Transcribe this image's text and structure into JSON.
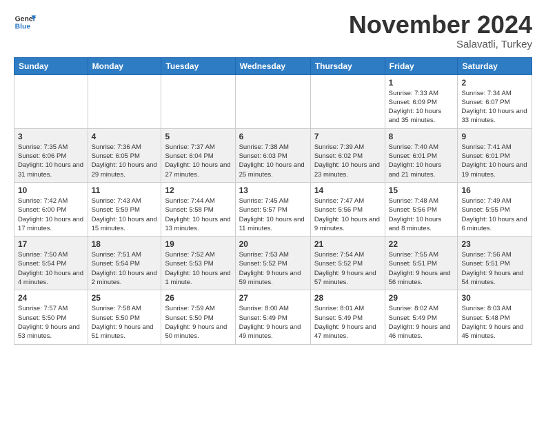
{
  "logo": {
    "line1": "General",
    "line2": "Blue"
  },
  "title": "November 2024",
  "subtitle": "Salavatli, Turkey",
  "days_of_week": [
    "Sunday",
    "Monday",
    "Tuesday",
    "Wednesday",
    "Thursday",
    "Friday",
    "Saturday"
  ],
  "weeks": [
    [
      {
        "day": "",
        "info": ""
      },
      {
        "day": "",
        "info": ""
      },
      {
        "day": "",
        "info": ""
      },
      {
        "day": "",
        "info": ""
      },
      {
        "day": "",
        "info": ""
      },
      {
        "day": "1",
        "info": "Sunrise: 7:33 AM\nSunset: 6:09 PM\nDaylight: 10 hours\nand 35 minutes."
      },
      {
        "day": "2",
        "info": "Sunrise: 7:34 AM\nSunset: 6:07 PM\nDaylight: 10 hours\nand 33 minutes."
      }
    ],
    [
      {
        "day": "3",
        "info": "Sunrise: 7:35 AM\nSunset: 6:06 PM\nDaylight: 10 hours\nand 31 minutes."
      },
      {
        "day": "4",
        "info": "Sunrise: 7:36 AM\nSunset: 6:05 PM\nDaylight: 10 hours\nand 29 minutes."
      },
      {
        "day": "5",
        "info": "Sunrise: 7:37 AM\nSunset: 6:04 PM\nDaylight: 10 hours\nand 27 minutes."
      },
      {
        "day": "6",
        "info": "Sunrise: 7:38 AM\nSunset: 6:03 PM\nDaylight: 10 hours\nand 25 minutes."
      },
      {
        "day": "7",
        "info": "Sunrise: 7:39 AM\nSunset: 6:02 PM\nDaylight: 10 hours\nand 23 minutes."
      },
      {
        "day": "8",
        "info": "Sunrise: 7:40 AM\nSunset: 6:01 PM\nDaylight: 10 hours\nand 21 minutes."
      },
      {
        "day": "9",
        "info": "Sunrise: 7:41 AM\nSunset: 6:01 PM\nDaylight: 10 hours\nand 19 minutes."
      }
    ],
    [
      {
        "day": "10",
        "info": "Sunrise: 7:42 AM\nSunset: 6:00 PM\nDaylight: 10 hours\nand 17 minutes."
      },
      {
        "day": "11",
        "info": "Sunrise: 7:43 AM\nSunset: 5:59 PM\nDaylight: 10 hours\nand 15 minutes."
      },
      {
        "day": "12",
        "info": "Sunrise: 7:44 AM\nSunset: 5:58 PM\nDaylight: 10 hours\nand 13 minutes."
      },
      {
        "day": "13",
        "info": "Sunrise: 7:45 AM\nSunset: 5:57 PM\nDaylight: 10 hours\nand 11 minutes."
      },
      {
        "day": "14",
        "info": "Sunrise: 7:47 AM\nSunset: 5:56 PM\nDaylight: 10 hours\nand 9 minutes."
      },
      {
        "day": "15",
        "info": "Sunrise: 7:48 AM\nSunset: 5:56 PM\nDaylight: 10 hours\nand 8 minutes."
      },
      {
        "day": "16",
        "info": "Sunrise: 7:49 AM\nSunset: 5:55 PM\nDaylight: 10 hours\nand 6 minutes."
      }
    ],
    [
      {
        "day": "17",
        "info": "Sunrise: 7:50 AM\nSunset: 5:54 PM\nDaylight: 10 hours\nand 4 minutes."
      },
      {
        "day": "18",
        "info": "Sunrise: 7:51 AM\nSunset: 5:54 PM\nDaylight: 10 hours\nand 2 minutes."
      },
      {
        "day": "19",
        "info": "Sunrise: 7:52 AM\nSunset: 5:53 PM\nDaylight: 10 hours\nand 1 minute."
      },
      {
        "day": "20",
        "info": "Sunrise: 7:53 AM\nSunset: 5:52 PM\nDaylight: 9 hours\nand 59 minutes."
      },
      {
        "day": "21",
        "info": "Sunrise: 7:54 AM\nSunset: 5:52 PM\nDaylight: 9 hours\nand 57 minutes."
      },
      {
        "day": "22",
        "info": "Sunrise: 7:55 AM\nSunset: 5:51 PM\nDaylight: 9 hours\nand 56 minutes."
      },
      {
        "day": "23",
        "info": "Sunrise: 7:56 AM\nSunset: 5:51 PM\nDaylight: 9 hours\nand 54 minutes."
      }
    ],
    [
      {
        "day": "24",
        "info": "Sunrise: 7:57 AM\nSunset: 5:50 PM\nDaylight: 9 hours\nand 53 minutes."
      },
      {
        "day": "25",
        "info": "Sunrise: 7:58 AM\nSunset: 5:50 PM\nDaylight: 9 hours\nand 51 minutes."
      },
      {
        "day": "26",
        "info": "Sunrise: 7:59 AM\nSunset: 5:50 PM\nDaylight: 9 hours\nand 50 minutes."
      },
      {
        "day": "27",
        "info": "Sunrise: 8:00 AM\nSunset: 5:49 PM\nDaylight: 9 hours\nand 49 minutes."
      },
      {
        "day": "28",
        "info": "Sunrise: 8:01 AM\nSunset: 5:49 PM\nDaylight: 9 hours\nand 47 minutes."
      },
      {
        "day": "29",
        "info": "Sunrise: 8:02 AM\nSunset: 5:49 PM\nDaylight: 9 hours\nand 46 minutes."
      },
      {
        "day": "30",
        "info": "Sunrise: 8:03 AM\nSunset: 5:48 PM\nDaylight: 9 hours\nand 45 minutes."
      }
    ]
  ]
}
